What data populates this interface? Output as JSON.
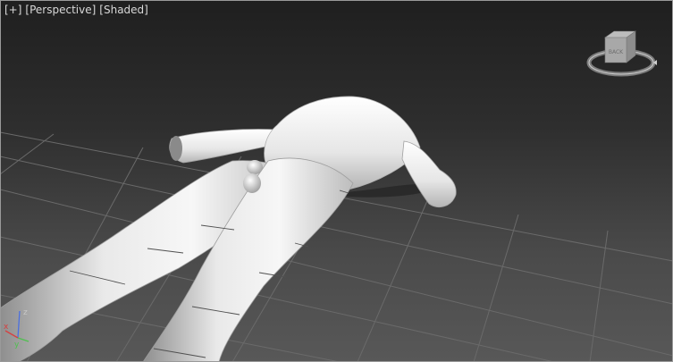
{
  "viewport": {
    "menu_plus": "[+]",
    "view_mode": "[Perspective]",
    "shading_mode": "[Shaded]"
  },
  "viewcube": {
    "face_label": "BACK"
  },
  "axes": {
    "x": "x",
    "y": "y",
    "z": "z",
    "x_color": "#d64040",
    "y_color": "#4fc04f",
    "z_color": "#4a6fe0"
  },
  "colors": {
    "grid_line": "#6a6a6a",
    "mesh_light": "#f2f2f2",
    "mesh_shadow": "#9a9a9a"
  }
}
